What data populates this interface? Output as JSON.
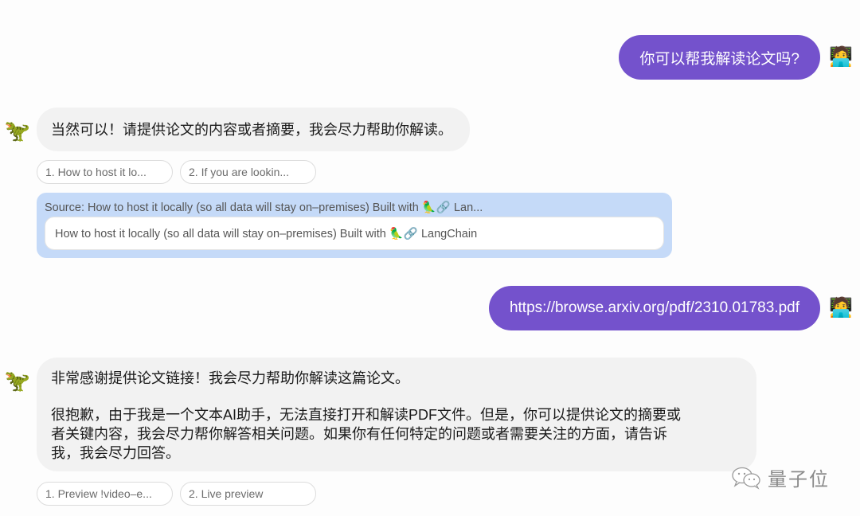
{
  "messages": [
    {
      "role": "user",
      "avatar_icon": "person-with-laptop-emoji",
      "avatar_glyph": "🧑‍💻",
      "text": "你可以帮我解读论文吗?"
    },
    {
      "role": "assistant",
      "avatar_icon": "t-rex-emoji",
      "avatar_glyph": "🦖",
      "text": "当然可以！请提供论文的内容或者摘要，我会尽力帮助你解读。",
      "suggestions": [
        "1. How to host it lo...",
        "2. If you are lookin..."
      ],
      "source": {
        "title": "Source: How to host it locally (so all data will stay on–premises) Built with 🦜🔗 Lan...",
        "content": "How to host it locally (so all data will stay on–premises) Built with 🦜🔗 LangChain"
      }
    },
    {
      "role": "user",
      "avatar_icon": "person-with-laptop-emoji",
      "avatar_glyph": "🧑‍💻",
      "text": "https://browse.arxiv.org/pdf/2310.01783.pdf"
    },
    {
      "role": "assistant",
      "avatar_icon": "t-rex-emoji",
      "avatar_glyph": "🦖",
      "paragraph1": "非常感谢提供论文链接！我会尽力帮助你解读这篇论文。",
      "paragraph2_lines": [
        "很抱歉，由于我是一个文本AI助手，无法直接打开和解读PDF文件。但是，你可以提供论文的摘要或",
        "者关键内容，我会尽力帮你解答相关问题。如果你有任何特定的问题或者需要关注的方面，请告诉",
        "我，我会尽力回答。"
      ],
      "suggestions": [
        "1. Preview !video–e...",
        "2. Live preview"
      ]
    }
  ],
  "watermark": {
    "icon": "wechat-icon",
    "text": "量子位"
  },
  "colors": {
    "user_bubble": "#7452cc",
    "bot_bubble": "#f2f2f2",
    "source_box": "#c5daf8"
  }
}
